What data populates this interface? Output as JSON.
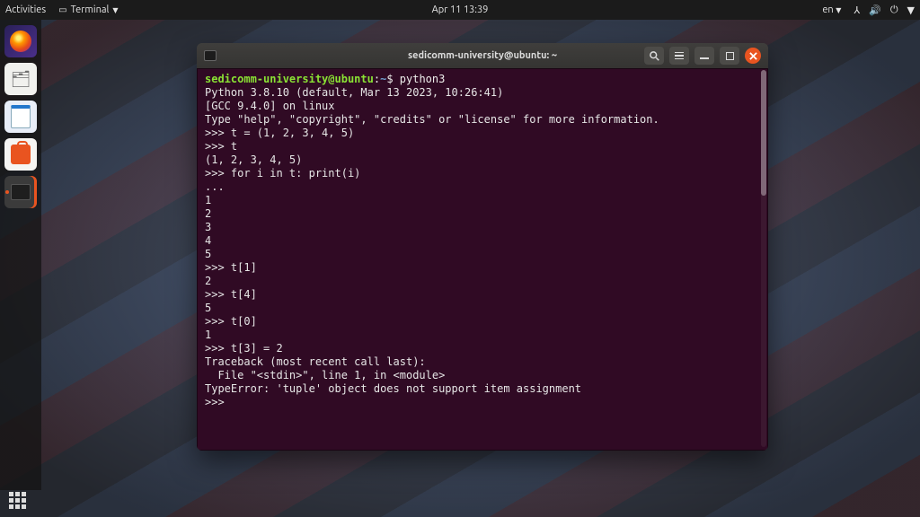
{
  "topbar": {
    "activities": "Activities",
    "app_menu": "Terminal",
    "datetime": "Apr 11  13:39",
    "lang": "en",
    "icons": {
      "net": "network-icon",
      "vol": "volume-icon",
      "power": "power-icon",
      "dropdown": "chevron-down-icon"
    }
  },
  "dock": {
    "items": [
      "firefox",
      "files",
      "writer",
      "software",
      "terminal"
    ],
    "active": "terminal"
  },
  "window": {
    "title": "sedicomm-university@ubuntu: ~",
    "controls": {
      "search": "search-icon",
      "menu": "menu-icon",
      "minimize": "minimize-icon",
      "maximize": "maximize-icon",
      "close": "close-icon"
    }
  },
  "terminal": {
    "prompt_user": "sedicomm-university@ubuntu",
    "prompt_path": "~",
    "prompt_suffix": "$",
    "command": "python3",
    "lines": [
      "Python 3.8.10 (default, Mar 13 2023, 10:26:41) ",
      "[GCC 9.4.0] on linux",
      "Type \"help\", \"copyright\", \"credits\" or \"license\" for more information.",
      ">>> t = (1, 2, 3, 4, 5)",
      ">>> t",
      "(1, 2, 3, 4, 5)",
      ">>> for i in t: print(i)",
      "... ",
      "1",
      "2",
      "3",
      "4",
      "5",
      ">>> t[1]",
      "2",
      ">>> t[4]",
      "5",
      ">>> t[0]",
      "1",
      ">>> t[3] = 2",
      "Traceback (most recent call last):",
      "  File \"<stdin>\", line 1, in <module>",
      "TypeError: 'tuple' object does not support item assignment",
      ">>> "
    ]
  },
  "colors": {
    "terminal_bg": "#300a24",
    "accent": "#e95420",
    "prompt_user": "#8ae234",
    "prompt_path": "#729fcf"
  }
}
